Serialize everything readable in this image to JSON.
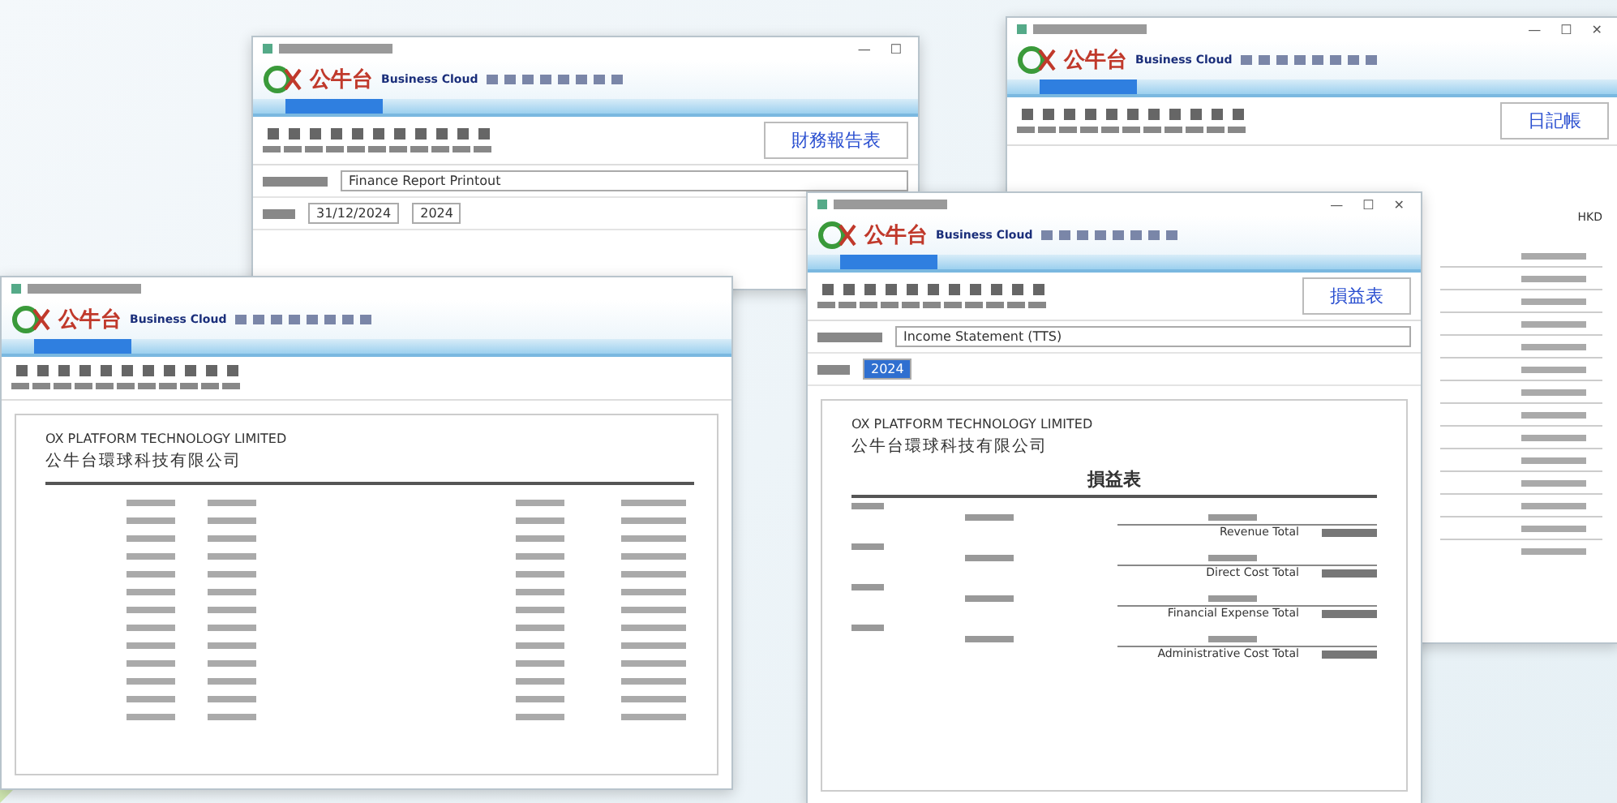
{
  "windows": [
    {
      "kind": "form",
      "window_controls": [
        "—",
        "☐"
      ],
      "logo": "公牛台",
      "logo_sub": "Business Cloud",
      "report_title": "財務報告表",
      "report_name": "Finance Report Printout",
      "date": "31/12/2024",
      "year": "2024",
      "year_selected": false
    },
    {
      "kind": "form",
      "window_controls": [
        "—",
        "☐",
        "✕"
      ],
      "logo": "公牛台",
      "logo_sub": "Business Cloud",
      "report_title": "日記帳",
      "side_column": [
        "HKD"
      ]
    },
    {
      "kind": "ledger",
      "logo": "公牛台",
      "logo_sub": "Business Cloud",
      "sheet": {
        "company": "OX PLATFORM TECHNOLOGY LIMITED",
        "company_cn": "公牛台環球科技有限公司"
      }
    },
    {
      "kind": "statement",
      "window_controls": [
        "—",
        "☐",
        "✕"
      ],
      "logo": "公牛台",
      "logo_sub": "Business Cloud",
      "report_title": "損益表",
      "report_name": "Income Statement (TTS)",
      "year": "2024",
      "year_selected": true,
      "sheet": {
        "company": "OX PLATFORM TECHNOLOGY LIMITED",
        "company_cn": "公牛台環球科技有限公司",
        "title": "損益表",
        "totals": [
          "Revenue Total",
          "Direct Cost Total",
          "Financial Expense Total",
          "Administrative Cost Total"
        ]
      }
    }
  ]
}
